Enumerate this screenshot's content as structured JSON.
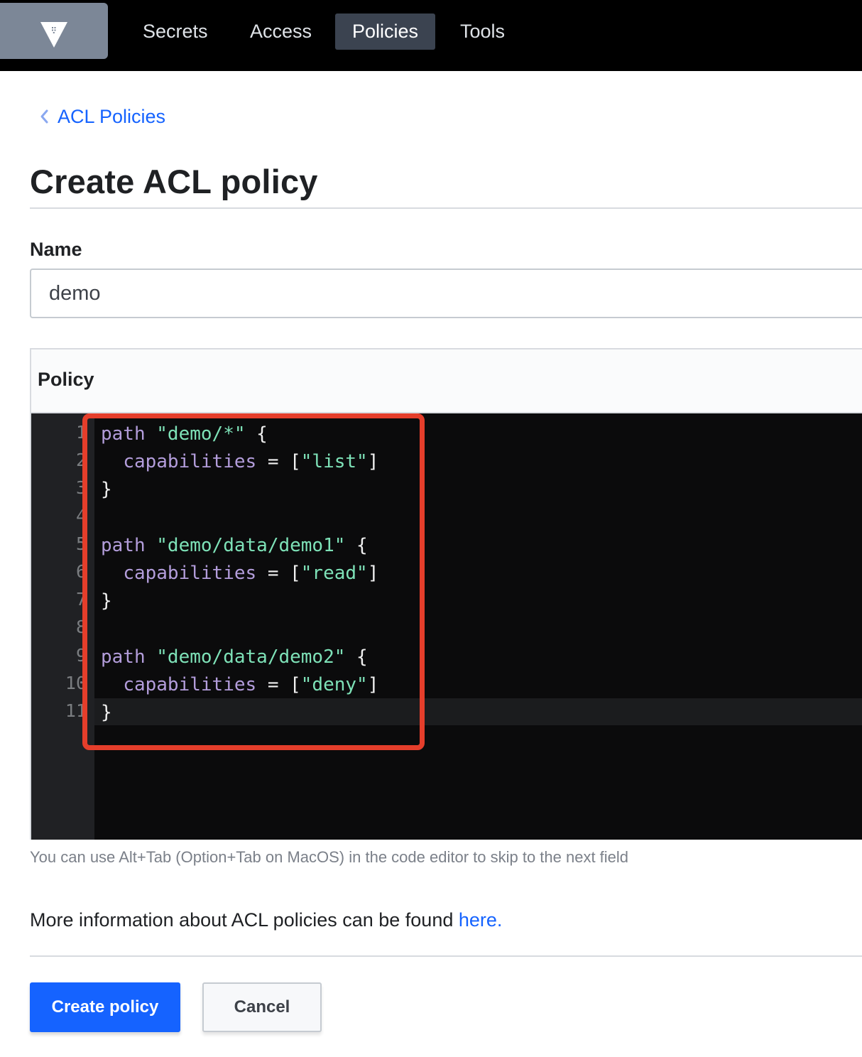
{
  "nav": {
    "logo_icon": "vault-logo-icon",
    "items": [
      {
        "label": "Secrets",
        "active": false
      },
      {
        "label": "Access",
        "active": false
      },
      {
        "label": "Policies",
        "active": true
      },
      {
        "label": "Tools",
        "active": false
      }
    ]
  },
  "breadcrumb": {
    "icon": "chevron-left-icon",
    "label": "ACL Policies"
  },
  "page": {
    "title": "Create ACL policy"
  },
  "form": {
    "name_label": "Name",
    "name_value": "demo",
    "policy_label": "Policy",
    "editor_help": "You can use Alt+Tab (Option+Tab on MacOS) in the code editor to skip to the next field",
    "info_text": "More information about ACL policies can be found ",
    "info_link": "here."
  },
  "editor": {
    "line_numbers": [
      "1",
      "2",
      "3",
      "4",
      "5",
      "6",
      "7",
      "8",
      "9",
      "10",
      "11"
    ],
    "lines": [
      "path \"demo/*\" {",
      "  capabilities = [\"list\"]",
      "}",
      "",
      "path \"demo/data/demo1\" {",
      "  capabilities = [\"read\"]",
      "}",
      "",
      "path \"demo/data/demo2\" {",
      "  capabilities = [\"deny\"]",
      "}"
    ]
  },
  "buttons": {
    "create": "Create policy",
    "cancel": "Cancel"
  },
  "colors": {
    "accent": "#1563ff",
    "nav_bg": "#000000",
    "highlight": "#e53e2b",
    "editor_bg": "#0b0b0c"
  }
}
